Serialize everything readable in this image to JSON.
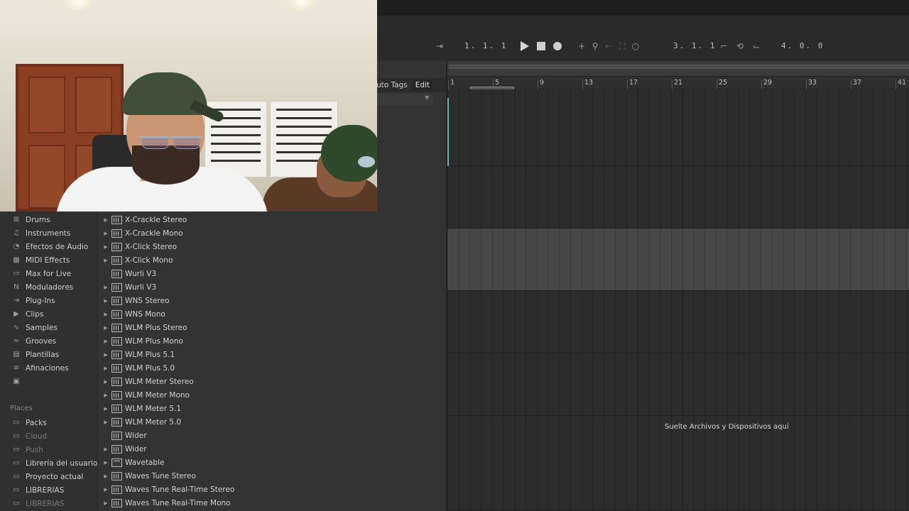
{
  "transport": {
    "arrangement_position": "1.  1.  1",
    "loop_start": "3.  1.  1",
    "loop_length": "4.  0.  0"
  },
  "browser_header": {
    "tags_label": "uto Tags",
    "edit_label": "Edit"
  },
  "categories": [
    {
      "label": "Drums",
      "icon": "drums-grid-icon"
    },
    {
      "label": "Instruments",
      "icon": "instruments-icon"
    },
    {
      "label": "Efectos de Audio",
      "icon": "audio-effects-icon"
    },
    {
      "label": "MIDI Effects",
      "icon": "midi-effects-icon"
    },
    {
      "label": "Max for Live",
      "icon": "max-for-live-icon"
    },
    {
      "label": "Moduladores",
      "icon": "modulators-icon"
    },
    {
      "label": "Plug-Ins",
      "icon": "plugins-icon"
    },
    {
      "label": "Clips",
      "icon": "clips-icon"
    },
    {
      "label": "Samples",
      "icon": "samples-icon"
    },
    {
      "label": "Grooves",
      "icon": "grooves-icon"
    },
    {
      "label": "Plantillas",
      "icon": "templates-icon"
    },
    {
      "label": "Afinaciones",
      "icon": "tunings-icon"
    }
  ],
  "places_heading": "Places",
  "places": [
    {
      "label": "Packs",
      "dim": false
    },
    {
      "label": "Cloud",
      "dim": true
    },
    {
      "label": "Push",
      "dim": true
    },
    {
      "label": "Librería del usuario",
      "dim": false
    },
    {
      "label": "Proyecto actual",
      "dim": false
    },
    {
      "label": "LIBRERIAS",
      "dim": false
    },
    {
      "label": "LIBRERIAS",
      "dim": true
    }
  ],
  "plugin_list": [
    {
      "label": "X-Crackle Stereo",
      "expandable": true,
      "folder": false
    },
    {
      "label": "X-Crackle Mono",
      "expandable": true,
      "folder": false
    },
    {
      "label": "X-Click Stereo",
      "expandable": true,
      "folder": false
    },
    {
      "label": "X-Click Mono",
      "expandable": true,
      "folder": false
    },
    {
      "label": "Wurli V3",
      "expandable": false,
      "folder": false
    },
    {
      "label": "Wurli V3",
      "expandable": true,
      "folder": false
    },
    {
      "label": "WNS Stereo",
      "expandable": true,
      "folder": false
    },
    {
      "label": "WNS Mono",
      "expandable": true,
      "folder": false
    },
    {
      "label": "WLM Plus Stereo",
      "expandable": true,
      "folder": false
    },
    {
      "label": "WLM Plus Mono",
      "expandable": true,
      "folder": false
    },
    {
      "label": "WLM Plus 5.1",
      "expandable": true,
      "folder": false
    },
    {
      "label": "WLM Plus 5.0",
      "expandable": true,
      "folder": false
    },
    {
      "label": "WLM Meter Stereo",
      "expandable": true,
      "folder": false
    },
    {
      "label": "WLM Meter Mono",
      "expandable": true,
      "folder": false
    },
    {
      "label": "WLM Meter 5.1",
      "expandable": true,
      "folder": false
    },
    {
      "label": "WLM Meter 5.0",
      "expandable": true,
      "folder": false
    },
    {
      "label": "Wider",
      "expandable": false,
      "folder": false
    },
    {
      "label": "Wider",
      "expandable": true,
      "folder": false
    },
    {
      "label": "Wavetable",
      "expandable": true,
      "folder": true
    },
    {
      "label": "Waves Tune Stereo",
      "expandable": true,
      "folder": false
    },
    {
      "label": "Waves Tune Real-Time Stereo",
      "expandable": true,
      "folder": false
    },
    {
      "label": "Waves Tune Real-Time Mono",
      "expandable": true,
      "folder": false
    }
  ],
  "ruler_bars": [
    "1",
    "5",
    "9",
    "13",
    "17",
    "21",
    "25",
    "29",
    "33",
    "37",
    "41"
  ],
  "drop_hint": "Suelte Archivos y Dispositivos aquí",
  "colors": {
    "playhead": "#5fb8c9",
    "selected_track": "#474747"
  }
}
